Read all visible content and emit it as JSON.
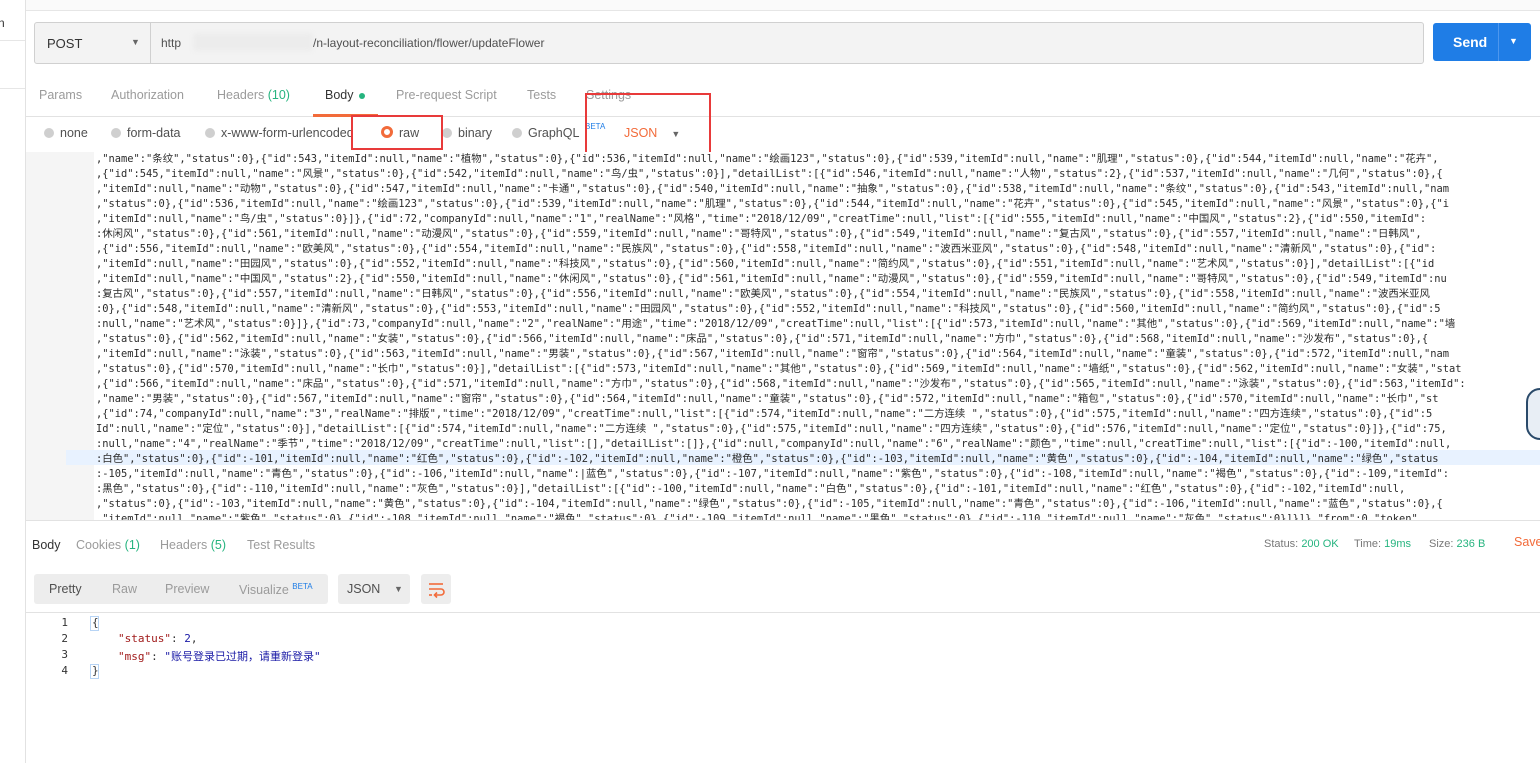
{
  "left_pane": {
    "fragment": "n"
  },
  "request": {
    "method": "POST",
    "url_prefix": "http",
    "url_path": "/n-layout-reconciliation/flower/updateFlower",
    "send_label": "Send"
  },
  "request_tabs": [
    {
      "label": "Params"
    },
    {
      "label": "Authorization"
    },
    {
      "label": "Headers",
      "count": "(10)"
    },
    {
      "label": "Body"
    },
    {
      "label": "Pre-request Script"
    },
    {
      "label": "Tests"
    },
    {
      "label": "Settings"
    }
  ],
  "body_types": [
    "none",
    "form-data",
    "x-www-form-urlencoded",
    "raw",
    "binary",
    "GraphQL"
  ],
  "body_type_badge": "BETA",
  "body_format": "JSON",
  "editor_lines": [
    ",\"name\":\"条纹\",\"status\":0},{\"id\":543,\"itemId\":null,\"name\":\"植物\",\"status\":0},{\"id\":536,\"itemId\":null,\"name\":\"绘画123\",\"status\":0},{\"id\":539,\"itemId\":null,\"name\":\"肌理\",\"status\":0},{\"id\":544,\"itemId\":null,\"name\":\"花卉\",",
    ",{\"id\":545,\"itemId\":null,\"name\":\"风景\",\"status\":0},{\"id\":542,\"itemId\":null,\"name\":\"鸟/虫\",\"status\":0}],\"detailList\":[{\"id\":546,\"itemId\":null,\"name\":\"人物\",\"status\":2},{\"id\":537,\"itemId\":null,\"name\":\"几何\",\"status\":0},{",
    ",\"itemId\":null,\"name\":\"动物\",\"status\":0},{\"id\":547,\"itemId\":null,\"name\":\"卡通\",\"status\":0},{\"id\":540,\"itemId\":null,\"name\":\"抽象\",\"status\":0},{\"id\":538,\"itemId\":null,\"name\":\"条纹\",\"status\":0},{\"id\":543,\"itemId\":null,\"nam",
    ",\"status\":0},{\"id\":536,\"itemId\":null,\"name\":\"绘画123\",\"status\":0},{\"id\":539,\"itemId\":null,\"name\":\"肌理\",\"status\":0},{\"id\":544,\"itemId\":null,\"name\":\"花卉\",\"status\":0},{\"id\":545,\"itemId\":null,\"name\":\"风景\",\"status\":0},{\"i",
    ",\"itemId\":null,\"name\":\"鸟/虫\",\"status\":0}]},{\"id\":72,\"companyId\":null,\"name\":\"1\",\"realName\":\"风格\",\"time\":\"2018/12/09\",\"creatTime\":null,\"list\":[{\"id\":555,\"itemId\":null,\"name\":\"中国风\",\"status\":2},{\"id\":550,\"itemId\":",
    ":休闲风\",\"status\":0},{\"id\":561,\"itemId\":null,\"name\":\"动漫风\",\"status\":0},{\"id\":559,\"itemId\":null,\"name\":\"哥特风\",\"status\":0},{\"id\":549,\"itemId\":null,\"name\":\"复古风\",\"status\":0},{\"id\":557,\"itemId\":null,\"name\":\"日韩风\",",
    ",{\"id\":556,\"itemId\":null,\"name\":\"欧美风\",\"status\":0},{\"id\":554,\"itemId\":null,\"name\":\"民族风\",\"status\":0},{\"id\":558,\"itemId\":null,\"name\":\"波西米亚风\",\"status\":0},{\"id\":548,\"itemId\":null,\"name\":\"清新风\",\"status\":0},{\"id\":",
    ",\"itemId\":null,\"name\":\"田园风\",\"status\":0},{\"id\":552,\"itemId\":null,\"name\":\"科技风\",\"status\":0},{\"id\":560,\"itemId\":null,\"name\":\"简约风\",\"status\":0},{\"id\":551,\"itemId\":null,\"name\":\"艺术风\",\"status\":0}],\"detailList\":[{\"id",
    ",\"itemId\":null,\"name\":\"中国风\",\"status\":2},{\"id\":550,\"itemId\":null,\"name\":\"休闲风\",\"status\":0},{\"id\":561,\"itemId\":null,\"name\":\"动漫风\",\"status\":0},{\"id\":559,\"itemId\":null,\"name\":\"哥特风\",\"status\":0},{\"id\":549,\"itemId\":nu",
    ":复古风\",\"status\":0},{\"id\":557,\"itemId\":null,\"name\":\"日韩风\",\"status\":0},{\"id\":556,\"itemId\":null,\"name\":\"欧美风\",\"status\":0},{\"id\":554,\"itemId\":null,\"name\":\"民族风\",\"status\":0},{\"id\":558,\"itemId\":null,\"name\":\"波西米亚风",
    ":0},{\"id\":548,\"itemId\":null,\"name\":\"清新风\",\"status\":0},{\"id\":553,\"itemId\":null,\"name\":\"田园风\",\"status\":0},{\"id\":552,\"itemId\":null,\"name\":\"科技风\",\"status\":0},{\"id\":560,\"itemId\":null,\"name\":\"简约风\",\"status\":0},{\"id\":5",
    ":null,\"name\":\"艺术风\",\"status\":0}]},{\"id\":73,\"companyId\":null,\"name\":\"2\",\"realName\":\"用途\",\"time\":\"2018/12/09\",\"creatTime\":null,\"list\":[{\"id\":573,\"itemId\":null,\"name\":\"其他\",\"status\":0},{\"id\":569,\"itemId\":null,\"name\":\"墙",
    ",\"status\":0},{\"id\":562,\"itemId\":null,\"name\":\"女装\",\"status\":0},{\"id\":566,\"itemId\":null,\"name\":\"床品\",\"status\":0},{\"id\":571,\"itemId\":null,\"name\":\"方巾\",\"status\":0},{\"id\":568,\"itemId\":null,\"name\":\"沙发布\",\"status\":0},{",
    ",\"itemId\":null,\"name\":\"泳装\",\"status\":0},{\"id\":563,\"itemId\":null,\"name\":\"男装\",\"status\":0},{\"id\":567,\"itemId\":null,\"name\":\"窗帘\",\"status\":0},{\"id\":564,\"itemId\":null,\"name\":\"童装\",\"status\":0},{\"id\":572,\"itemId\":null,\"nam",
    ",\"status\":0},{\"id\":570,\"itemId\":null,\"name\":\"长巾\",\"status\":0}],\"detailList\":[{\"id\":573,\"itemId\":null,\"name\":\"其他\",\"status\":0},{\"id\":569,\"itemId\":null,\"name\":\"墙纸\",\"status\":0},{\"id\":562,\"itemId\":null,\"name\":\"女装\",\"stat",
    ",{\"id\":566,\"itemId\":null,\"name\":\"床品\",\"status\":0},{\"id\":571,\"itemId\":null,\"name\":\"方巾\",\"status\":0},{\"id\":568,\"itemId\":null,\"name\":\"沙发布\",\"status\":0},{\"id\":565,\"itemId\":null,\"name\":\"泳装\",\"status\":0},{\"id\":563,\"itemId\":",
    ",\"name\":\"男装\",\"status\":0},{\"id\":567,\"itemId\":null,\"name\":\"窗帘\",\"status\":0},{\"id\":564,\"itemId\":null,\"name\":\"童装\",\"status\":0},{\"id\":572,\"itemId\":null,\"name\":\"箱包\",\"status\":0},{\"id\":570,\"itemId\":null,\"name\":\"长巾\",\"st",
    ",{\"id\":74,\"companyId\":null,\"name\":\"3\",\"realName\":\"排版\",\"time\":\"2018/12/09\",\"creatTime\":null,\"list\":[{\"id\":574,\"itemId\":null,\"name\":\"二方连续 \",\"status\":0},{\"id\":575,\"itemId\":null,\"name\":\"四方连续\",\"status\":0},{\"id\":5",
    "Id\":null,\"name\":\"定位\",\"status\":0}],\"detailList\":[{\"id\":574,\"itemId\":null,\"name\":\"二方连续 \",\"status\":0},{\"id\":575,\"itemId\":null,\"name\":\"四方连续\",\"status\":0},{\"id\":576,\"itemId\":null,\"name\":\"定位\",\"status\":0}]},{\"id\":75,",
    ":null,\"name\":\"4\",\"realName\":\"季节\",\"time\":\"2018/12/09\",\"creatTime\":null,\"list\":[],\"detailList\":[]},{\"id\":null,\"companyId\":null,\"name\":\"6\",\"realName\":\"颜色\",\"time\":null,\"creatTime\":null,\"list\":[{\"id\":-100,\"itemId\":null,",
    ":白色\",\"status\":0},{\"id\":-101,\"itemId\":null,\"name\":\"红色\",\"status\":0},{\"id\":-102,\"itemId\":null,\"name\":\"橙色\",\"status\":0},{\"id\":-103,\"itemId\":null,\"name\":\"黄色\",\"status\":0},{\"id\":-104,\"itemId\":null,\"name\":\"绿色\",\"status",
    ":-105,\"itemId\":null,\"name\":\"青色\",\"status\":0},{\"id\":-106,\"itemId\":null,\"name\":|蓝色\",\"status\":0},{\"id\":-107,\"itemId\":null,\"name\":\"紫色\",\"status\":0},{\"id\":-108,\"itemId\":null,\"name\":\"褐色\",\"status\":0},{\"id\":-109,\"itemId\":",
    ":黑色\",\"status\":0},{\"id\":-110,\"itemId\":null,\"name\":\"灰色\",\"status\":0}],\"detailList\":[{\"id\":-100,\"itemId\":null,\"name\":\"白色\",\"status\":0},{\"id\":-101,\"itemId\":null,\"name\":\"红色\",\"status\":0},{\"id\":-102,\"itemId\":null,",
    ",\"status\":0},{\"id\":-103,\"itemId\":null,\"name\":\"黄色\",\"status\":0},{\"id\":-104,\"itemId\":null,\"name\":\"绿色\",\"status\":0},{\"id\":-105,\"itemId\":null,\"name\":\"青色\",\"status\":0},{\"id\":-106,\"itemId\":null,\"name\":\"蓝色\",\"status\":0},{",
    ",\"itemId\":null,\"name\":\"紫色\",\"status\":0},{\"id\":-108,\"itemId\":null,\"name\":\"褐色\",\"status\":0},{\"id\":-109,\"itemId\":null,\"name\":\"黑色\",\"status\":0},{\"id\":-110,\"itemId\":null,\"name\":\"灰色\",\"status\":0}]}]},\"from\":0,\"token\"",
    ":\"eyJhbGciOiJIUzI1NiJ9.eyJpYXQiOjE1NzMxOTgyNDYsInN1YiI6IntcImlkXCI6MTg5fSIsImV4cCI6MTU3NDQwNzg0Nn0.S6Km2YAsBeT10OYfMq_9DR_tptDxyiGbnLWnQbSLkjQ\"}"
  ],
  "response_tabs": [
    {
      "label": "Body"
    },
    {
      "label": "Cookies",
      "count": "(1)"
    },
    {
      "label": "Headers",
      "count": "(5)"
    },
    {
      "label": "Test Results"
    }
  ],
  "response_meta": {
    "status_label": "Status:",
    "status_value": "200 OK",
    "time_label": "Time:",
    "time_value": "19ms",
    "size_label": "Size:",
    "size_value": "236 B",
    "save_label": "Save"
  },
  "response_view": {
    "modes": [
      "Pretty",
      "Raw",
      "Preview",
      "Visualize"
    ],
    "visualize_badge": "BETA",
    "format": "JSON"
  },
  "response_body": {
    "line_numbers": [
      "1",
      "2",
      "3",
      "4"
    ],
    "open": "{",
    "status_key": "\"status\"",
    "status_value": "2",
    "msg_key": "\"msg\"",
    "msg_value": "\"账号登录已过期，请重新登录\"",
    "close": "}"
  },
  "colors": {
    "accent": "#f26b3a",
    "send": "#1f7de6",
    "success": "#26b47f",
    "annotation": "#e83a3a"
  }
}
